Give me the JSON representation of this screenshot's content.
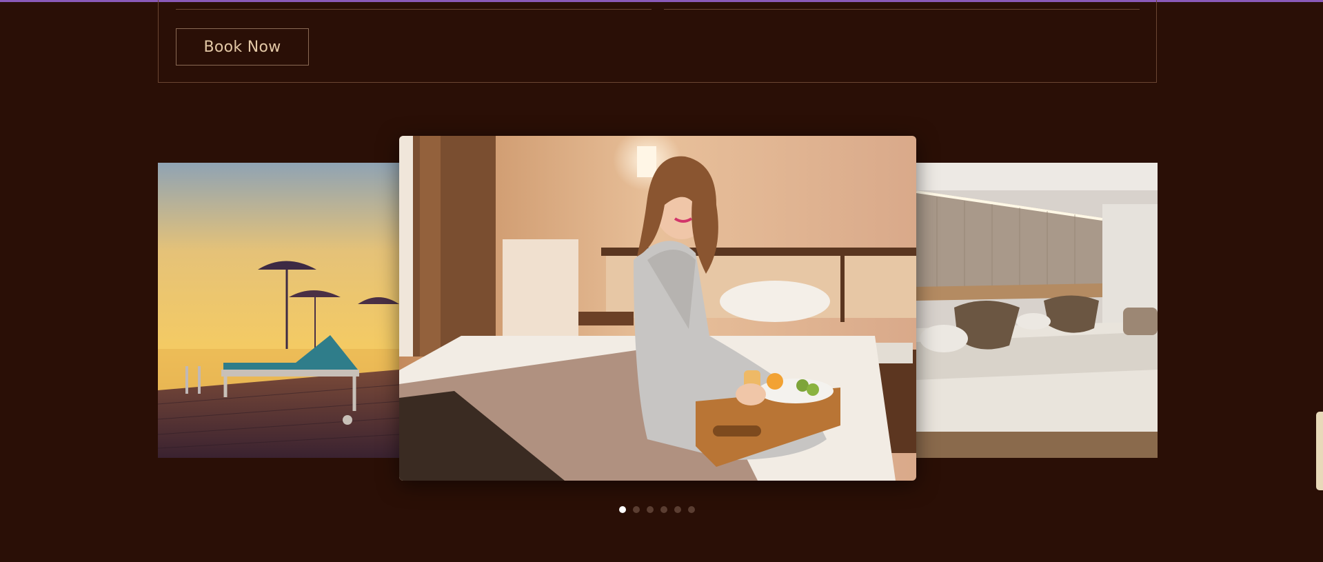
{
  "booking": {
    "book_button_label": "Book Now"
  },
  "carousel": {
    "slides": [
      {
        "name": "pool-deck-sunset"
      },
      {
        "name": "guest-breakfast-in-room"
      },
      {
        "name": "double-room-interior"
      }
    ],
    "dot_count": 6,
    "active_index": 0
  },
  "colors": {
    "background": "#2a0f06",
    "accent_topbar": "#8a5ab8",
    "button_text": "#e3c8a6",
    "dot_active": "#ffffff",
    "dot_inactive": "#5b3e32",
    "scrollbar": "#e8d9b9"
  }
}
